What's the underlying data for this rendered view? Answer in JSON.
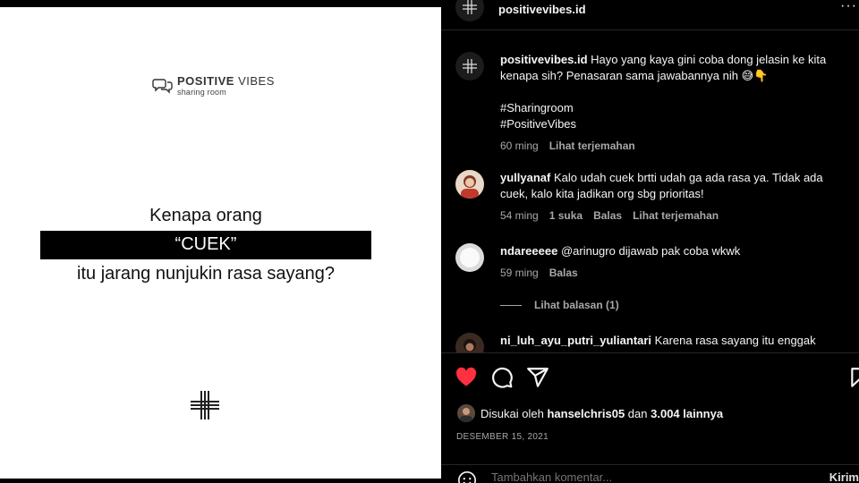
{
  "post_image": {
    "brand_bold": "POSITIVE",
    "brand_light": "VIBES",
    "brand_sub": "sharing room",
    "line1": "Kenapa orang",
    "line2": "“CUEK”",
    "line3": "itu jarang nunjukin rasa sayang?"
  },
  "header": {
    "username": "positivevibes.id",
    "more_icon": "more-horizontal-icon"
  },
  "comments": [
    {
      "user": "positivevibes.id",
      "text": "Hayo yang kaya gini coba dong jelasin ke kita kenapa sih? Penasaran sama jawabannya nih 😅👇",
      "tags": [
        "#Sharingroom",
        "#PositiveVibes"
      ],
      "time": "60 ming",
      "translate": "Lihat terjemahan"
    },
    {
      "user": "yullyanaf",
      "text": "Kalo udah cuek brtti udah ga ada rasa ya. Tidak ada cuek, kalo kita jadikan org sbg prioritas!",
      "time": "54 ming",
      "likes": "1 suka",
      "reply": "Balas",
      "translate": "Lihat terjemahan"
    },
    {
      "user": "ndareeeee",
      "text": "@arinugro dijawab pak coba wkwk",
      "time": "59 ming",
      "reply": "Balas",
      "view_replies": "Lihat balasan (1)"
    },
    {
      "user": "ni_luh_ayu_putri_yuliantari",
      "text": "Karena rasa sayang itu enggak"
    }
  ],
  "actions": {
    "liked_color": "#ff3040",
    "likes_prefix": "Disukai oleh",
    "likes_user": "hanselchris05",
    "likes_and": "dan",
    "likes_count": "3.004 lainnya",
    "date": "DESEMBER 15, 2021"
  },
  "add_comment": {
    "placeholder": "Tambahkan komentar...",
    "post_label": "Kirim"
  }
}
